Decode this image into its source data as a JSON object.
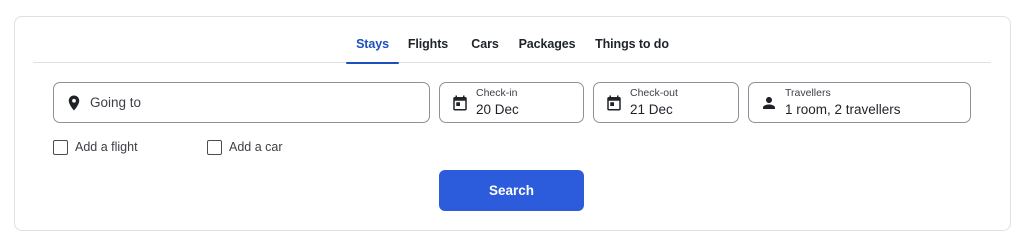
{
  "tabs": [
    {
      "label": "Stays",
      "active": true
    },
    {
      "label": "Flights",
      "active": false
    },
    {
      "label": "Cars",
      "active": false
    },
    {
      "label": "Packages",
      "active": false
    },
    {
      "label": "Things to do",
      "active": false
    }
  ],
  "destination": {
    "placeholder": "Going to",
    "icon": "map-pin-icon"
  },
  "checkin": {
    "label": "Check-in",
    "value": "20 Dec",
    "icon": "calendar-icon"
  },
  "checkout": {
    "label": "Check-out",
    "value": "21 Dec",
    "icon": "calendar-icon"
  },
  "travellers": {
    "label": "Travellers",
    "value": "1 room, 2 travellers",
    "icon": "person-icon"
  },
  "options": {
    "add_flight": "Add a flight",
    "add_car": "Add a car"
  },
  "search": {
    "label": "Search"
  },
  "colors": {
    "accent": "#1e4fbe",
    "button": "#2c5bdc",
    "border": "#8e9198"
  }
}
